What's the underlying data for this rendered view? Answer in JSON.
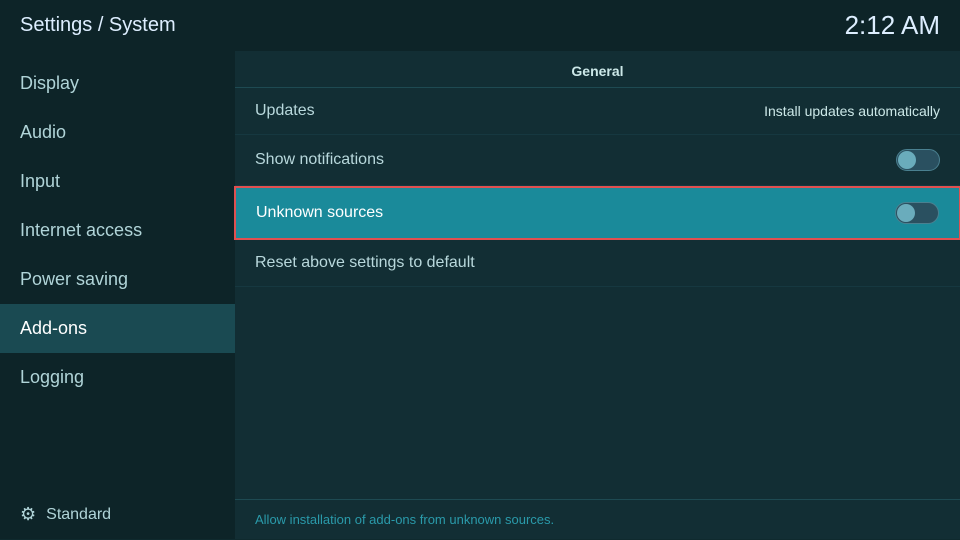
{
  "header": {
    "title": "Settings / System",
    "time": "2:12 AM"
  },
  "sidebar": {
    "items": [
      {
        "id": "display",
        "label": "Display",
        "active": false
      },
      {
        "id": "audio",
        "label": "Audio",
        "active": false
      },
      {
        "id": "input",
        "label": "Input",
        "active": false
      },
      {
        "id": "internet-access",
        "label": "Internet access",
        "active": false
      },
      {
        "id": "power-saving",
        "label": "Power saving",
        "active": false
      },
      {
        "id": "add-ons",
        "label": "Add-ons",
        "active": true
      },
      {
        "id": "logging",
        "label": "Logging",
        "active": false
      }
    ],
    "bottom_label": "Standard"
  },
  "main": {
    "section_header": "General",
    "settings": [
      {
        "id": "updates",
        "label": "Updates",
        "value": "Install updates automatically",
        "toggle": false,
        "highlighted": false
      },
      {
        "id": "show-notifications",
        "label": "Show notifications",
        "value": "",
        "toggle": true,
        "toggle_state": "off",
        "highlighted": false
      },
      {
        "id": "unknown-sources",
        "label": "Unknown sources",
        "value": "",
        "toggle": true,
        "toggle_state": "off",
        "highlighted": true
      },
      {
        "id": "reset-settings",
        "label": "Reset above settings to default",
        "value": "",
        "toggle": false,
        "highlighted": false
      }
    ],
    "footer": "Allow installation of add-ons from unknown sources."
  }
}
